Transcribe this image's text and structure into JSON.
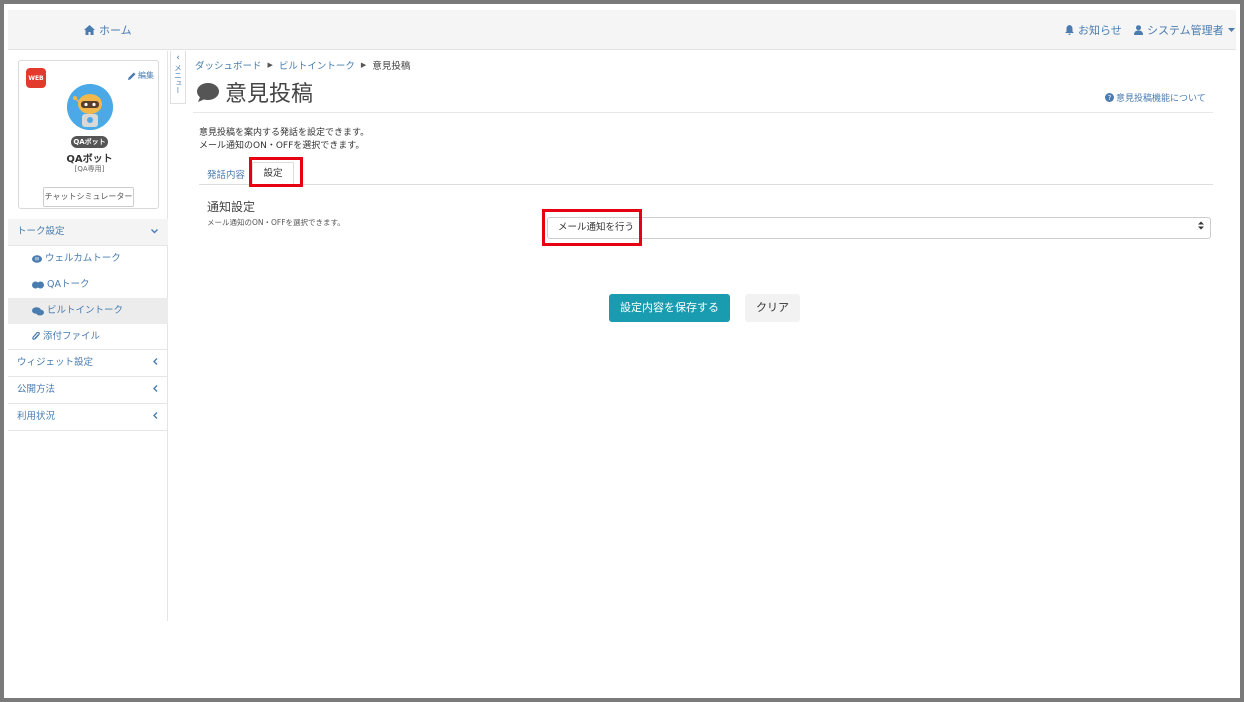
{
  "topbar": {
    "home_label": "ホーム",
    "notice_label": "お知らせ",
    "admin_label": "システム管理者"
  },
  "profile": {
    "badge_text": "WEB",
    "edit_label": "編集",
    "bot_tag": "QAボット",
    "bot_name": "QAボット",
    "bot_sub": "[QA専用]",
    "simulator_label": "チャットシミュレーター"
  },
  "sidebar": {
    "collapse_label": "メニュー",
    "items": [
      {
        "label": "トーク設定",
        "icon": "chevron-down-icon"
      },
      {
        "label": "ウェルカムトーク",
        "icon": "welcome-talk-icon"
      },
      {
        "label": "QAトーク",
        "icon": "qa-talk-icon"
      },
      {
        "label": "ビルトイントーク",
        "icon": "comments-icon"
      },
      {
        "label": "添付ファイル",
        "icon": "paperclip-icon"
      },
      {
        "label": "ウィジェット設定",
        "icon": "chevron-left-icon"
      },
      {
        "label": "公開方法",
        "icon": "chevron-left-icon"
      },
      {
        "label": "利用状況",
        "icon": "chevron-left-icon"
      }
    ]
  },
  "breadcrumb": {
    "items": [
      "ダッシュボード",
      "ビルトイントーク",
      "意見投稿"
    ]
  },
  "page": {
    "title": "意見投稿",
    "help_link": "意見投稿機能について",
    "desc1": "意見投稿を案内する発話を設定できます。",
    "desc2": "メール通知のON・OFFを選択できます。"
  },
  "tabs": {
    "content": "発話内容",
    "settings": "設定"
  },
  "notification": {
    "label": "通知設定",
    "help": "メール通知のON・OFFを選択できます。",
    "selected_value": "メール通知を行う"
  },
  "actions": {
    "save_label": "設定内容を保存する",
    "clear_label": "クリア"
  },
  "colors": {
    "accent": "#1a9cb0",
    "link": "#4a7cb0",
    "highlight": "#e60012"
  }
}
